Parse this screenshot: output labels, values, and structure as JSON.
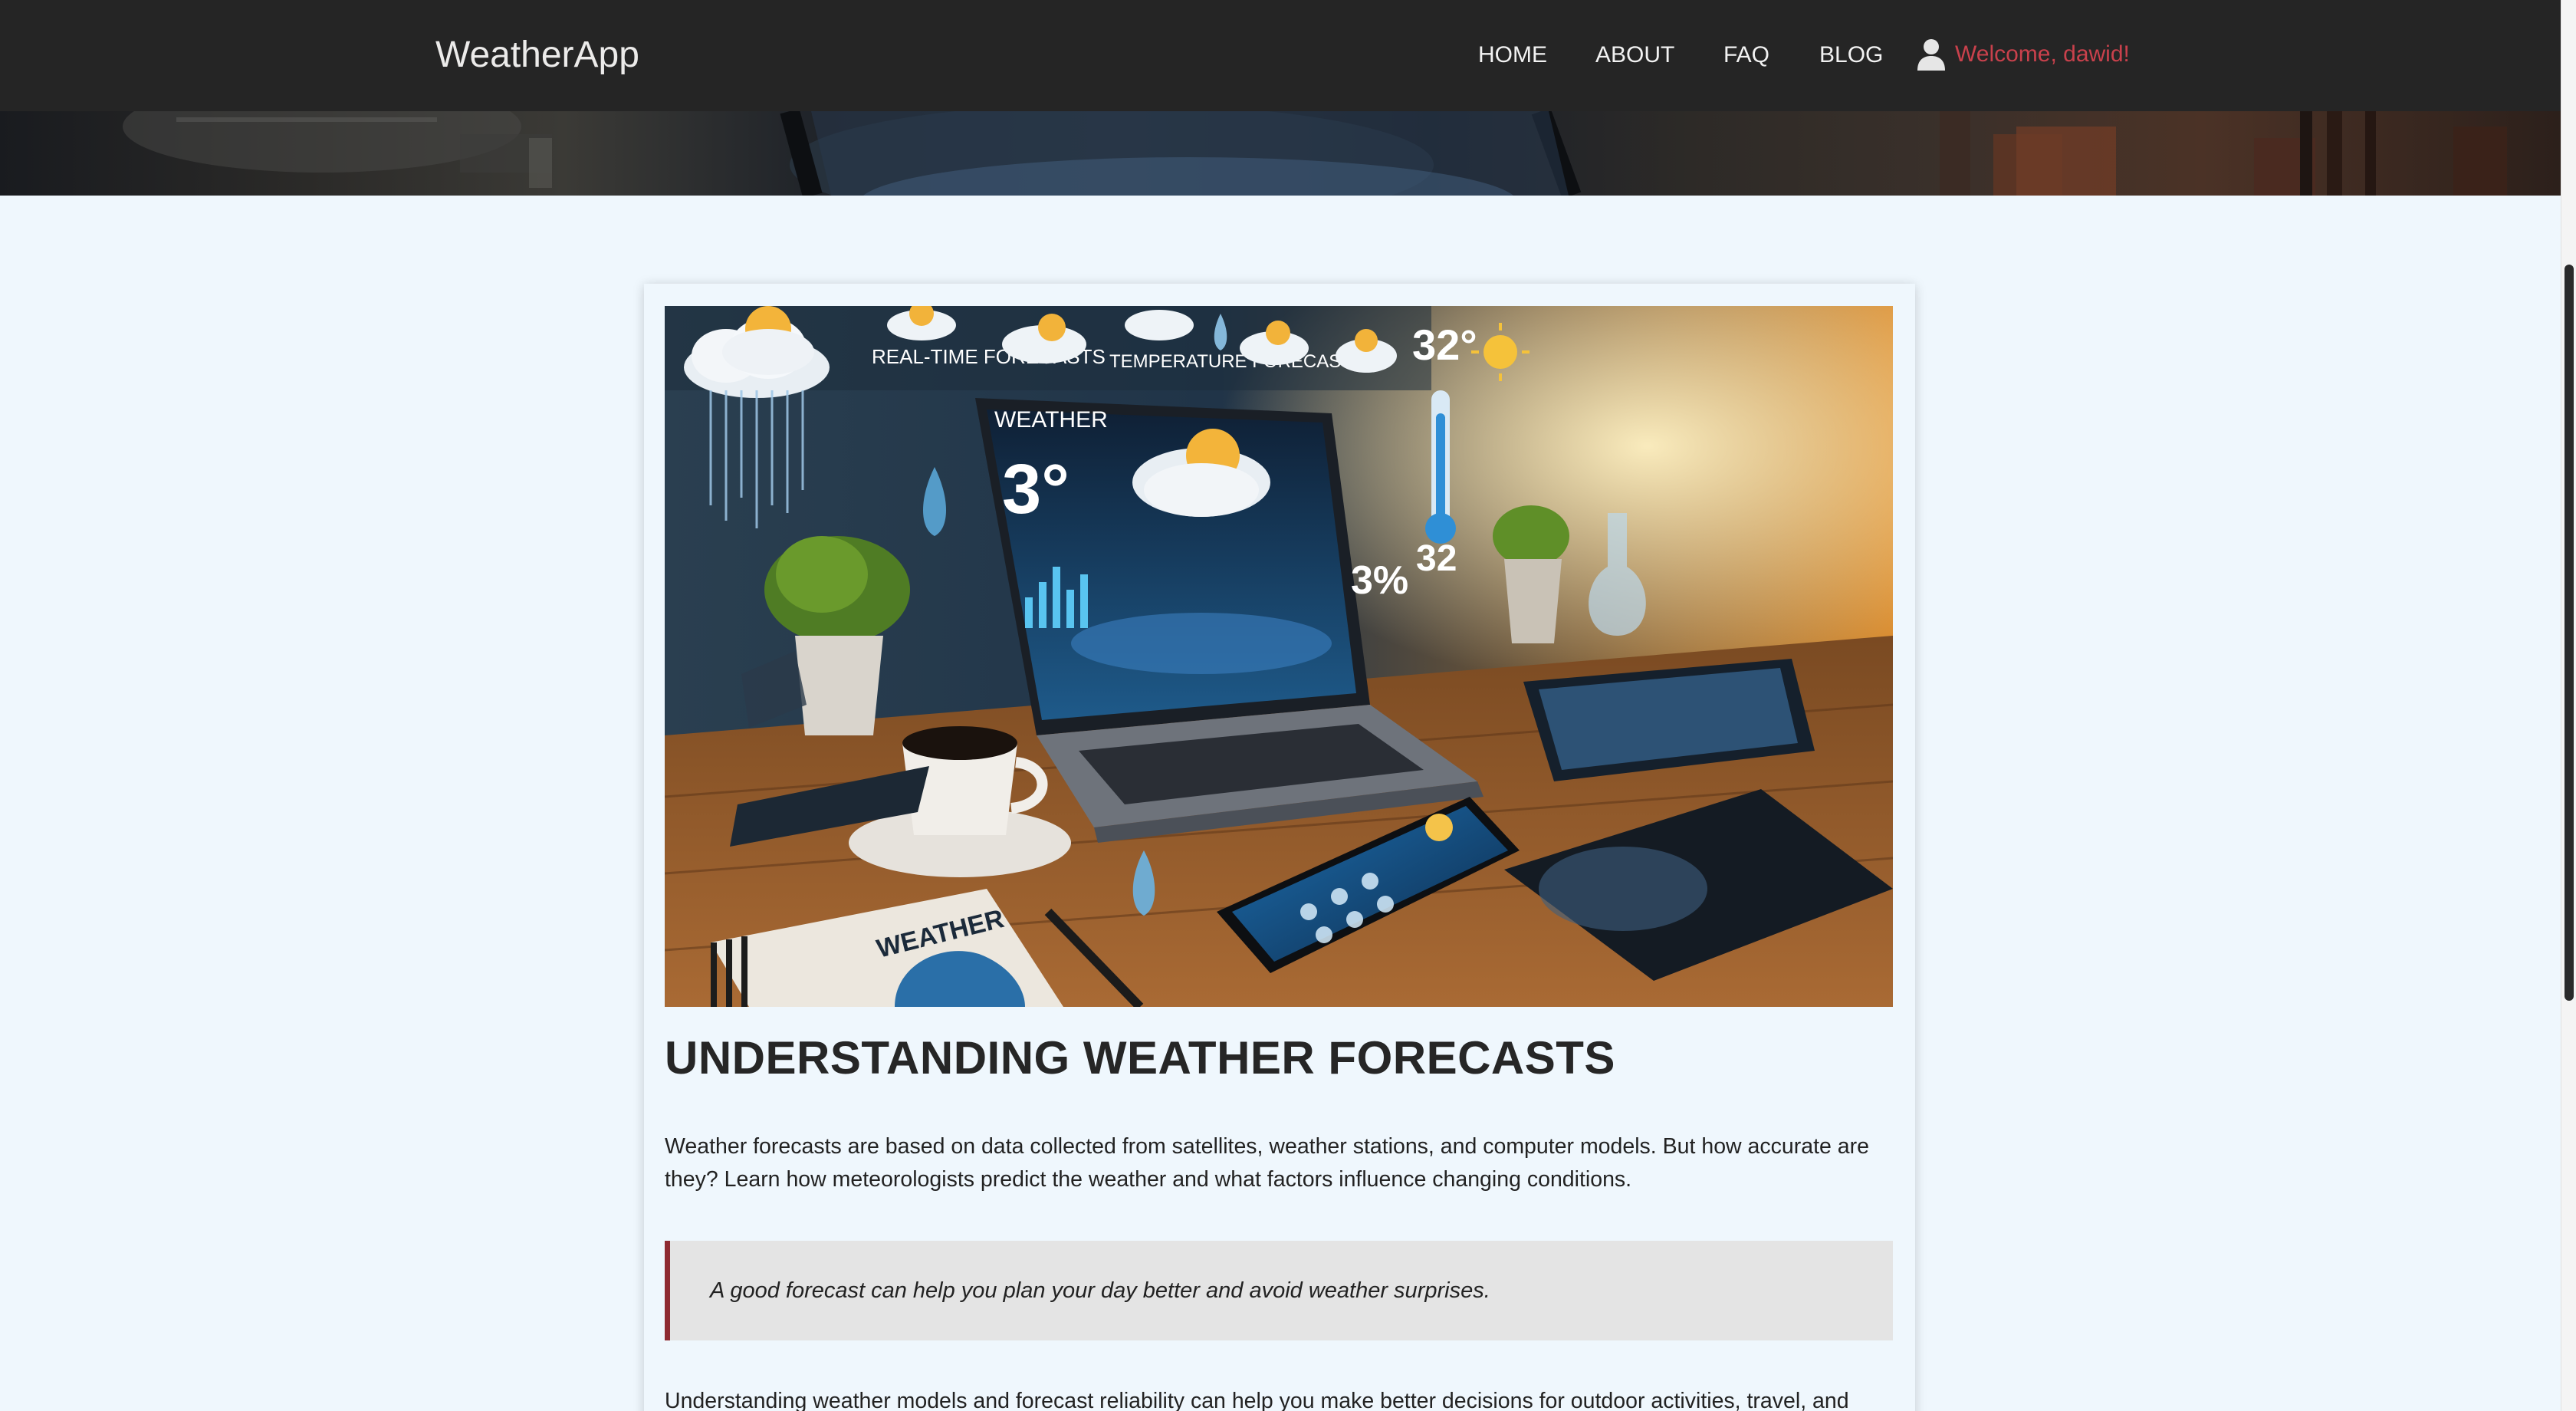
{
  "navbar": {
    "brand": "WeatherApp",
    "links": [
      "HOME",
      "ABOUT",
      "FAQ",
      "BLOG"
    ],
    "welcome": "Welcome, dawid!",
    "user_icon": "user-icon",
    "welcome_color": "#c9414c",
    "background": "#252525"
  },
  "hero": {
    "image": "dark technology city banner with monitor and buildings"
  },
  "article": {
    "image_labels": {
      "realtime": "REAL-TIME FORECASTS",
      "temperature": "TEMPERATURE FORECASTS",
      "screen_title": "WEATHER",
      "screen_temp": "3°",
      "side_temp": "32°",
      "side_value": "32",
      "side_percent": "3%",
      "notebook": "WEATHER"
    },
    "title": "UNDERSTANDING WEATHER FORECASTS",
    "paragraph1": "Weather forecasts are based on data collected from satellites, weather stations, and computer models. But how accurate are they? Learn how meteorologists predict the weather and what factors influence changing conditions.",
    "quote": "A good forecast can help you plan your day better and avoid weather surprises.",
    "paragraph2": "Understanding weather models and forecast reliability can help you make better decisions for outdoor activities, travel, and",
    "quote_border_color": "#8e2a31"
  },
  "scrollbar": {
    "position": 0.19
  }
}
